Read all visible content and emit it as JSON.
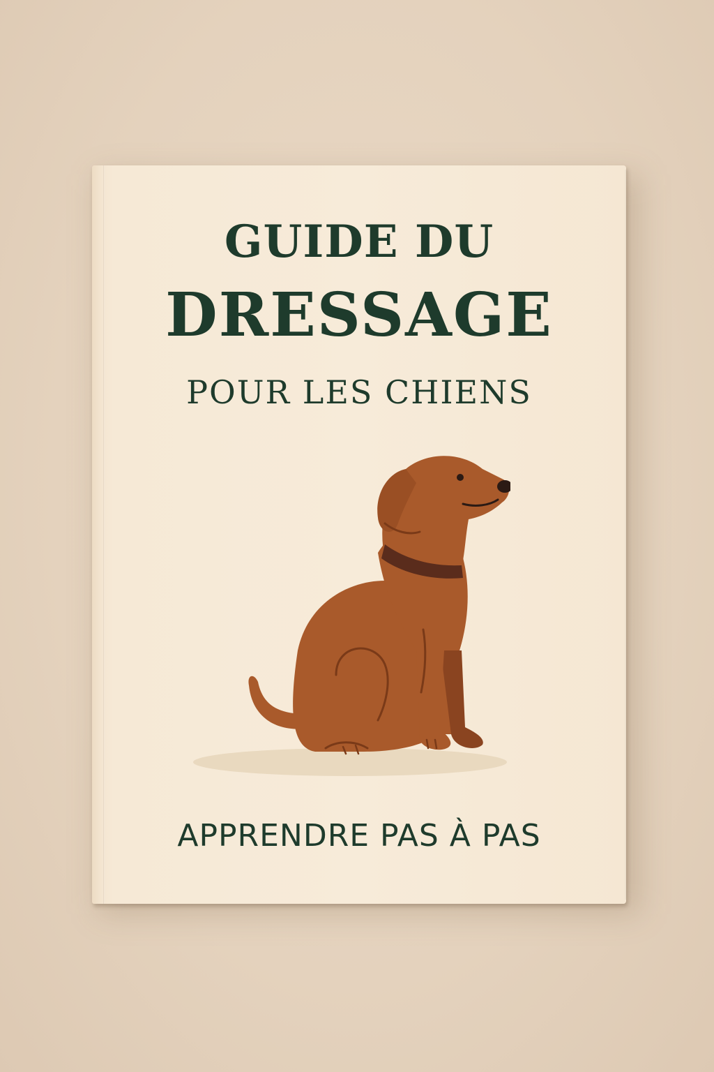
{
  "cover": {
    "title_line1": "GUIDE DU",
    "title_line2": "DRESSAGE",
    "title_line3": "POUR LES CHIENS",
    "subtitle": "APPRENDRE PAS À PAS"
  },
  "illustration": {
    "icon": "sitting-dog-icon"
  },
  "colors": {
    "background": "#e6d5c2",
    "cover": "#f7ebd9",
    "title_text": "#1e3b2c",
    "dog_body": "#a95a2b",
    "dog_shade": "#8a4420",
    "collar": "#5a2c1c"
  }
}
